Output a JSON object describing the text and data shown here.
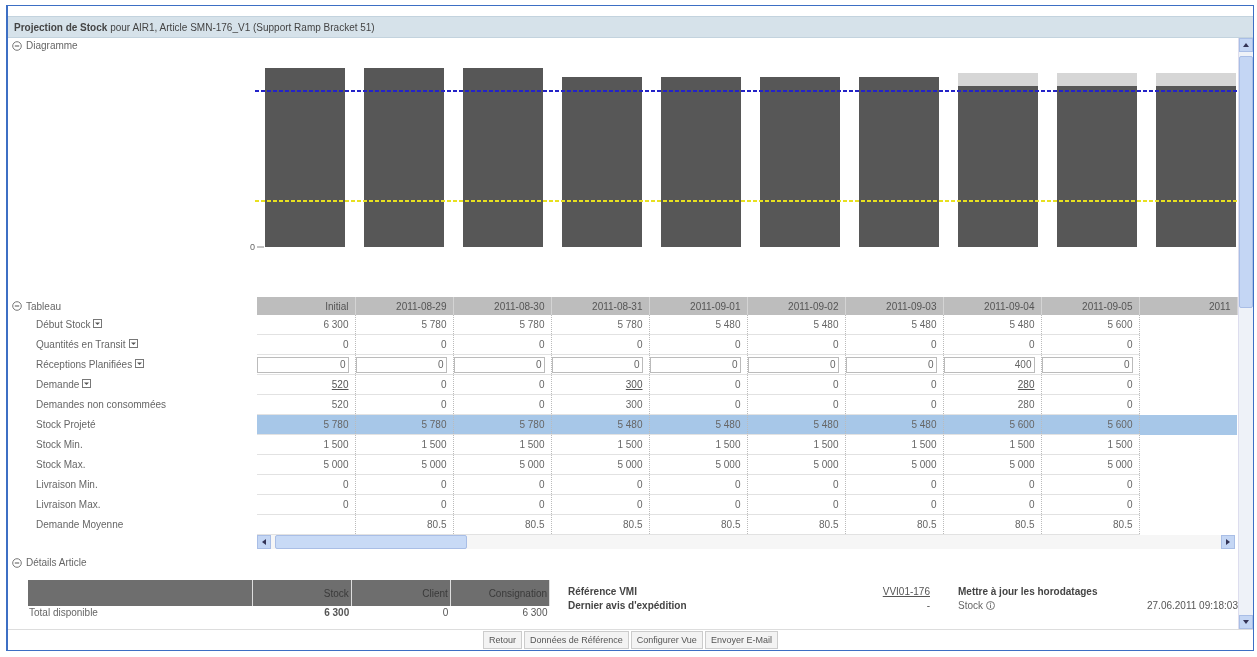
{
  "window": {
    "title": "**Projection de Stock** pour AIR1, Article SMN-176_V1 (Support Ramp Bracket 51)"
  },
  "sections": [
    {
      "label": "Diagramme",
      "expanded": true
    },
    {
      "label": "Tableau",
      "expanded": true
    },
    {
      "label": "Détails Article",
      "expanded": true
    }
  ],
  "chart": {
    "y_tick": "0"
  },
  "table": {
    "columns": [
      "Initial",
      "2011-08-29",
      "2011-08-30",
      "2011-08-31",
      "2011-09-01",
      "2011-09-02",
      "2011-09-03",
      "2011-09-04",
      "2011-09-05",
      "2011"
    ],
    "rows": [
      {
        "label": "Début Stock",
        "menu": true,
        "kind": "text",
        "selected": false,
        "cells": [
          "6 300",
          "5 780",
          "5 780",
          "5 780",
          "5 480",
          "5 480",
          "5 480",
          "5 480",
          "5 600"
        ]
      },
      {
        "label": "Quantités en Transit",
        "menu": true,
        "kind": "text",
        "selected": false,
        "cells": [
          "0",
          "0",
          "0",
          "0",
          "0",
          "0",
          "0",
          "0",
          "0"
        ]
      },
      {
        "label": "Réceptions Planifiées",
        "menu": true,
        "kind": "input",
        "selected": false,
        "cells": [
          "0",
          "0",
          "0",
          "0",
          "0",
          "0",
          "0",
          "400",
          "0"
        ]
      },
      {
        "label": "Demande",
        "menu": true,
        "kind": "mixed",
        "selected": false,
        "cells": [
          {
            "text": "520",
            "link": true
          },
          {
            "text": "0",
            "link": false
          },
          {
            "text": "0",
            "link": false
          },
          {
            "text": "300",
            "link": true
          },
          {
            "text": "0",
            "link": false
          },
          {
            "text": "0",
            "link": false
          },
          {
            "text": "0",
            "link": false
          },
          {
            "text": "280",
            "link": true
          },
          {
            "text": "0",
            "link": false
          }
        ]
      },
      {
        "label": "Demandes non consommées",
        "menu": false,
        "kind": "text",
        "selected": false,
        "cells": [
          "520",
          "0",
          "0",
          "300",
          "0",
          "0",
          "0",
          "280",
          "0"
        ]
      },
      {
        "label": "Stock Projeté",
        "menu": false,
        "kind": "text",
        "selected": true,
        "cells": [
          "5 780",
          "5 780",
          "5 780",
          "5 480",
          "5 480",
          "5 480",
          "5 480",
          "5 600",
          "5 600"
        ]
      },
      {
        "label": "Stock Min.",
        "menu": false,
        "kind": "text",
        "selected": false,
        "cells": [
          "1 500",
          "1 500",
          "1 500",
          "1 500",
          "1 500",
          "1 500",
          "1 500",
          "1 500",
          "1 500"
        ]
      },
      {
        "label": "Stock Max.",
        "menu": false,
        "kind": "text",
        "selected": false,
        "cells": [
          "5 000",
          "5 000",
          "5 000",
          "5 000",
          "5 000",
          "5 000",
          "5 000",
          "5 000",
          "5 000"
        ]
      },
      {
        "label": "Livraison Min.",
        "menu": false,
        "kind": "text",
        "selected": false,
        "cells": [
          "0",
          "0",
          "0",
          "0",
          "0",
          "0",
          "0",
          "0",
          "0"
        ]
      },
      {
        "label": "Livraison Max.",
        "menu": false,
        "kind": "text",
        "selected": false,
        "cells": [
          "0",
          "0",
          "0",
          "0",
          "0",
          "0",
          "0",
          "0",
          "0"
        ]
      },
      {
        "label": "Demande Moyenne",
        "menu": false,
        "kind": "text",
        "selected": false,
        "cells": [
          "",
          "80.5",
          "80.5",
          "80.5",
          "80.5",
          "80.5",
          "80.5",
          "80.5",
          "80.5"
        ]
      }
    ]
  },
  "details": {
    "columns": [
      "Stock",
      "Client",
      "Consignation"
    ],
    "row": {
      "label": "Total disponible",
      "cells": [
        "6 300",
        "0",
        "6 300"
      ]
    },
    "fields": [
      {
        "label": "Référence VMI",
        "value": "VVI01-176",
        "link": true
      },
      {
        "label": "Dernier avis d'expédition",
        "value": "-",
        "link": false
      }
    ],
    "timestamps": {
      "title": "Mettre à jour les horodatages",
      "label": "Stock",
      "value": "27.06.2011 09:18:03"
    }
  },
  "buttons": [
    "Retour",
    "Données de Référence",
    "Configurer Vue",
    "Envoyer E-Mail"
  ]
}
